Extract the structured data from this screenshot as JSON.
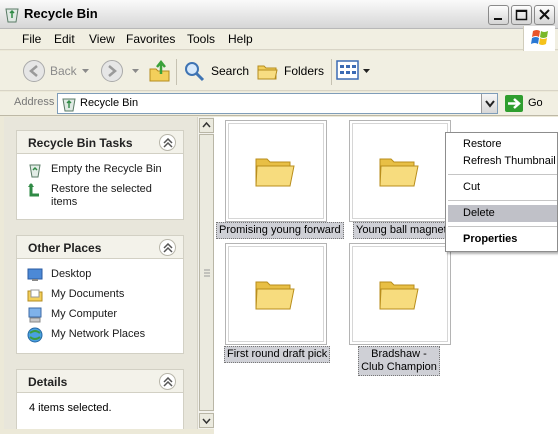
{
  "window": {
    "title": "Recycle Bin"
  },
  "menu": [
    "File",
    "Edit",
    "View",
    "Favorites",
    "Tools",
    "Help"
  ],
  "toolbar": {
    "back": "Back",
    "search": "Search",
    "folders": "Folders"
  },
  "address": {
    "label": "Address",
    "value": "Recycle Bin",
    "go": "Go"
  },
  "tasks_panel": {
    "title": "Recycle Bin Tasks",
    "items": [
      "Empty the Recycle Bin",
      "Restore the selected items"
    ]
  },
  "places_panel": {
    "title": "Other Places",
    "items": [
      "Desktop",
      "My Documents",
      "My Computer",
      "My Network Places"
    ]
  },
  "details_panel": {
    "title": "Details",
    "text": "4 items selected."
  },
  "files": [
    "Promising young forward",
    "Young ball magnet",
    "First round draft pick",
    "Bradshaw - Club Champion"
  ],
  "context_menu": {
    "items": [
      "Restore",
      "Refresh Thumbnail",
      "Cut",
      "Delete",
      "Properties"
    ],
    "highlighted": "Delete"
  },
  "colors": {
    "folder": "#f4d774",
    "selection": "#cfd0d6",
    "panel_bg": "#e8e6db"
  }
}
